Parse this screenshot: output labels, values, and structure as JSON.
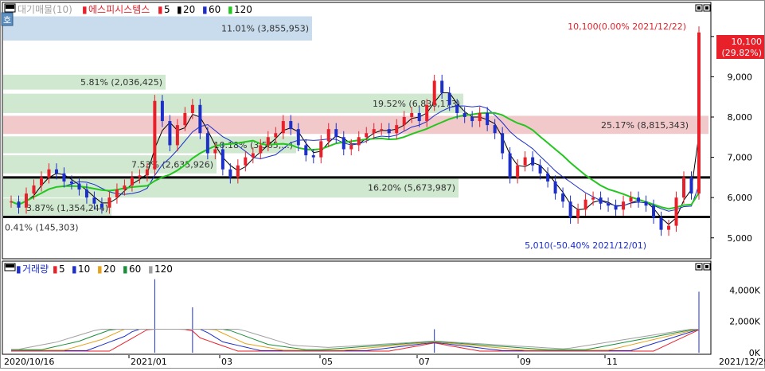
{
  "legend": {
    "price": {
      "label_prefix": "대기매물(10)",
      "label_stock": "에스피시스템스",
      "ma": [
        {
          "label": "5",
          "color": "#e8202a"
        },
        {
          "label": "20",
          "color": "#000000"
        },
        {
          "label": "60",
          "color": "#1d2fc9"
        },
        {
          "label": "120",
          "color": "#22c61e"
        }
      ]
    },
    "volume": {
      "label": "거래량",
      "ma": [
        {
          "label": "5",
          "color": "#e8202a"
        },
        {
          "label": "10",
          "color": "#1d2fc9"
        },
        {
          "label": "20",
          "color": "#e5a21b"
        },
        {
          "label": "60",
          "color": "#1a8f3a"
        },
        {
          "label": "120",
          "color": "#a0a0a0"
        }
      ]
    }
  },
  "colors": {
    "up": "#e8202a",
    "down": "#1d2fc9",
    "band_blue": "#c8dced",
    "band_green": "#cfe8cf",
    "band_red": "#f1c9cb",
    "axis": "#000000"
  },
  "chart_data": [
    {
      "type": "candlestick",
      "title": "에스피시스템스",
      "x_start": "2020/10/16",
      "x_end": "2021/12/29",
      "x_tick_labels": [
        "2020/10/16",
        "2021/01",
        "03",
        "05",
        "07",
        "09",
        "11",
        "2021/12/29"
      ],
      "y_ticks": [
        "5,000",
        "6,000",
        "7,000",
        "8,000",
        "9,000",
        "10,000"
      ],
      "ylim": [
        4580,
        10550
      ],
      "volume_profile": [
        {
          "low": 9900,
          "high": 10500,
          "text": "11.01% (3,855,953)",
          "kind": "blue"
        },
        {
          "low": 8680,
          "high": 9050,
          "text": "5.81% (2,036,425)",
          "kind": "green"
        },
        {
          "low": 8100,
          "high": 8580,
          "text": "19.52% (6,836,173)",
          "kind": "green"
        },
        {
          "low": 7580,
          "high": 8030,
          "text": "25.17% (8,815,343)",
          "kind": "red"
        },
        {
          "low": 7100,
          "high": 7520,
          "text": "10.18% (3,565,...)",
          "kind": "green"
        },
        {
          "low": 6600,
          "high": 7050,
          "text": "7.53% (2,635,926)",
          "kind": "green"
        },
        {
          "low": 6000,
          "high": 6500,
          "text": "16.20% (5,673,987)",
          "kind": "green"
        },
        {
          "low": 5520,
          "high": 5980,
          "text": "3.87% (1,354,244)",
          "kind": "green"
        },
        {
          "low": 5050,
          "high": 5480,
          "text": "0.41% (145,303)",
          "kind": "green"
        }
      ],
      "horizontal_lines": [
        6500,
        5520
      ],
      "annotations": [
        {
          "text": "10,100(0.00% 2021/12/22)",
          "value": 10100
        },
        {
          "text": "5,010(-50.40% 2021/12/01)",
          "value": 5010
        }
      ],
      "current_price_label": [
        "10,100",
        "(29.82%)"
      ],
      "price_path": [
        5900,
        5750,
        6100,
        6300,
        6500,
        6700,
        6600,
        6400,
        6350,
        6200,
        6000,
        5850,
        5750,
        6000,
        6200,
        6300,
        6500,
        6550,
        6700,
        8400,
        7900,
        7300,
        7800,
        8100,
        8300,
        7600,
        7100,
        7200,
        6700,
        6500,
        6800,
        7000,
        7100,
        7300,
        7500,
        7600,
        7900,
        7700,
        7300,
        7050,
        7000,
        7400,
        7700,
        7500,
        7200,
        7300,
        7500,
        7600,
        7700,
        7700,
        7600,
        7800,
        8000,
        8100,
        7900,
        8300,
        8900,
        8600,
        8300,
        8100,
        8000,
        7900,
        8100,
        7800,
        7600,
        7100,
        6500,
        6800,
        7000,
        6800,
        6600,
        6400,
        6100,
        5900,
        5500,
        5700,
        5950,
        6000,
        5850,
        5800,
        5700,
        5900,
        6000,
        5900,
        5800,
        5500,
        5200,
        5300,
        6000,
        6500,
        6100,
        10100
      ],
      "volume_spikes": [
        {
          "index": 19,
          "value": 4700000
        },
        {
          "index": 24,
          "value": 2900000
        },
        {
          "index": 56,
          "value": 1500000
        },
        {
          "index": 91,
          "value": 3900000
        }
      ]
    },
    {
      "type": "bar",
      "title": "거래량",
      "y_ticks": [
        "0K",
        "2,000K",
        "4,000K"
      ],
      "ylim": [
        0,
        5500000
      ]
    }
  ]
}
